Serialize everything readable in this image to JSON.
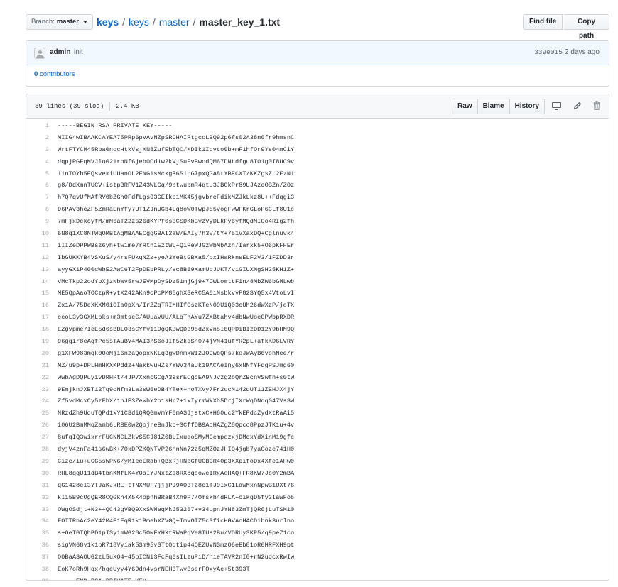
{
  "topbar": {
    "branch_label": "Branch:",
    "branch_value": "master",
    "path": {
      "repo": "keys",
      "dir1": "keys",
      "dir2": "master",
      "file": "master_key_1.txt",
      "sep": "/"
    },
    "find_file_label": "Find file",
    "copy_path_label": "Copy path"
  },
  "commit": {
    "author": "admin",
    "message": "init",
    "sha": "339e015",
    "time": "2 days ago",
    "contributors_count": "0",
    "contributors_label": "contributors"
  },
  "file": {
    "lines_info": "39 lines (39 sloc)",
    "size": "2.4 KB",
    "raw_label": "Raw",
    "blame_label": "Blame",
    "history_label": "History",
    "icons": [
      "desktop-icon",
      "pencil-icon",
      "trash-icon"
    ],
    "lines": [
      "-----BEGIN RSA PRIVATE KEY-----",
      "MIIG4wIBAAKCAYEA75PRp6pVAvNZpSROHAIRtgcoLBQ92p6fs02A38n0fr9hmsnC",
      "WrtFTYCM45Rba0nocHtkVsjXN8ZufEbTQC/KDIk1Icvto0b+mF1hfOr9Ys04mCiY",
      "dqpjPGEqMVJlo021rbNf6jeb0Od1w2kVjSuFvBwodQM67DNtdfgu8T01g0I8UC9v",
      "1inTOYb5EQsvekiUUanOL2ENG1sMckgB6S1pG7pxQGA8tYBECXT/KKZgsZL2EzN1",
      "g8/DdXmnTUCV+istpBRFV1Z43WLGq/9btwubmR4qtu3JBCkPr89UJAzeOBZn/ZOz",
      "h7Q7qvUfMAfRV0bZGhOFdfLgs93GEIkp1MK45jgvbrcFdikMZJkLkz8U++Fdqgi3",
      "D6PAv3hcZF5ZmRaEnYfy7UT1ZJnUGb4Lq8oW0TwpJ55vogFwWFKrGLoP6CLf8U1c",
      "7mFjxDckcyfM/mM6aT22zs26dKYPf0s3CSDKbBvzVyDLkPy6yfMQdMIOo4RIg2fh",
      "6N8q1XC8NTWqOMBtAgMBAAECggGBAI2aW/EAIy7h3V/tY+751VXaxDQ+Cglnuvk4",
      "iIIZeDPPWBsz6yh+tw1me7rRth1EztWL+QiReWJGzWbMbAzh/Iarxk5+O6pKFHEr",
      "IbGUKKYB4VSKuS/y4rsFUkqNZz+yeA3YeBtGBXa5/bxIHaRknsELF2V3/1FZDD3r",
      "ayyGX1P400cWbE2AwC6T2FpDEbPRLy/sc8B69XamUbJUKT/viGIUXNgSH25KH1Z+",
      "VMcTkp22odYpXjzNbWv5rwJEVMpDySDz51mjGj9+7OWLomttFin/8MbZW6bGMLwb",
      "ME5QpAaoTOCzpR+ytX242AKn9cPcPM88ghXSeRC5A6iNsbkvvF82SYQ5x4VtoLvI",
      "Zx1A/75DeXKXM0iOIa0pXh/IrZZqTRIMHIfOszKTeN09UiQ03cUh26dWXzP/joTX",
      "ccoL3y3GXMLpks+m3mtseC/AUuaVUU/ALqThAYu7ZXBtahv4dbNwUocOPWbpRXDR",
      "EZgvpme7IeE5d6sBBLO3sCYfv119gQKBwQD395dZxvn5I6QPDiBIzDD12Y9bHM9Q",
      "96ggir8eAqfPc5sTAuBV4MAI3/S6oJIf5ZkqSn074jVN41ufYR2pL+afkKD6LVRY",
      "g1XFW983mqk0OoMji6nzaQopxNKLq3gwDnmxWI2JO9wbQFs7koJWAyB6vohNee/r",
      "MZ/u9p+DPLHmHKXKPddz+NakkwuHZs7YWV34aUk19ACAeIny6xNNfYFqgPSJmg60",
      "wwbAgDQPuyivDRHPt/4JP7XxncGCgA3ssrECgcEA9NJvzg2bQrZBcnvSwfh+s0tW",
      "9EmjknJXBT12Tq9cNfm3La3sW6eDB4YTeX+hoTXVy7Fr2ocN142qUT11ZEHJX4jY",
      "Zf5vdMcxCy5zFbX/1hJE3ZewhY2o1sHr7+1xIyrmWkXh5DrjIXrWqDNqqG47VsSW",
      "NRzdZh9UquTQPd1xY1CSdiQRQGmVmYF0mASJjstxC+H60uc2YkEPdcZydXtRaAi5",
      "i06U2BmMMqZamb6LRBE0w2QojreBnJkp+3CffDB9AoHAZgZ8Qpco8PpzJTK1u+4v",
      "8ufqIQ3wixrrFUCNNCLZkvS5CJ81Z0BLIxuqoSMyMGempozxjDMdxYdXinM19gfc",
      "dyjV4znFa41s6wBK+70kDPZKQNTVP26nnNn72z5qMZOzJHIQ4jgb7yaCozc741H0",
      "Cizc/iu+uGG5sWPN6/yMIecERab+QBxRjHNoGfUGBGR40p3XXpifoDx4Xfe1AHw0",
      "RHL8qqU11dB4tbnKMfLK4YOaIYJNxtZs8RX8qcowcIRxAoHAQ+FR8KW7Jb0Y2mBA",
      "qG1428eI3YTJaKJxRE+tTNXMUF7jjjPJ9AO3Tz8e1TJ9IxC1LawMxnNpwB1UXt76",
      "kIi5B9cOgQER8CQGkh4X5K4opnhBRaB4Xh9P7/Omskh4dRLA+cikgD5fy2IawFo5",
      "OWgOSdjt+N3++QC43gVBQ9XxSWMeqMkJ53267+v34upnJYN83ZmTjQR0jLuTSM10",
      "FOTTRnAc2eY42M4E1EqR1k1BmebXZVGQ+TmvGTZ5c3ficHGVAoHACDibnk3urlno",
      "s+GeTGTQbPD1pISyimWG28c5OwFYHXtRWaPqVe8IUs2Bu/VDRUy3KP5/q9peZ1co",
      "sigVN68v1k1bR718Vyiak5Sm95vSTt0dtip44QEZUvNSmzO6eEb81oR6HRFXH9pt",
      "O0BaASAOUG2zL5uXO4+45bICNi3FcFq6sILzuPiD/nieTAVR2nI0+rN2udcxRwIw",
      "EoK7oRh9Hqx/bqcUyy4Y69dn4ysrNEH3TwvBserFOxyAe+5t393T",
      "-----END RSA PRIVATE KEY-----"
    ]
  }
}
